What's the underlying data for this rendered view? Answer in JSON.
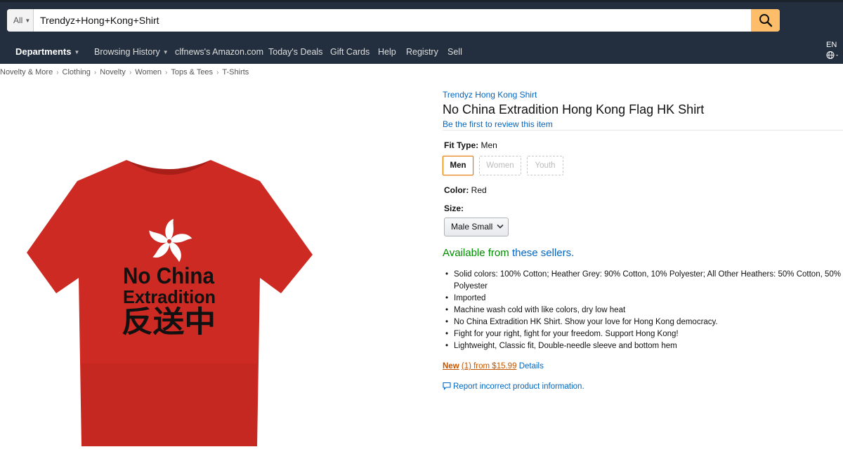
{
  "search": {
    "category": "All",
    "query": "Trendyz+Hong+Kong+Shirt",
    "button_icon": "search-icon"
  },
  "nav": {
    "departments": "Departments",
    "browsing_history": "Browsing History",
    "amazon_link": "clfnews's Amazon.com",
    "todays_deals": "Today's Deals",
    "gift_cards": "Gift Cards",
    "help": "Help",
    "registry": "Registry",
    "sell": "Sell",
    "language": "EN",
    "globe_icon": "globe-icon"
  },
  "breadcrumb": [
    "Novelty & More",
    "Clothing",
    "Novelty",
    "Women",
    "Tops & Tees",
    "T-Shirts"
  ],
  "product": {
    "brand": "Trendyz Hong Kong Shirt",
    "title": "No China Extradition Hong Kong Flag HK Shirt",
    "review_link": "Be the first to review this item",
    "shirt_color_hex": "#cc2a22",
    "print": {
      "line1": "No China",
      "line2": "Extradition",
      "line3": "反送中"
    },
    "fit_type": {
      "label": "Fit Type:",
      "value": "Men",
      "options": [
        "Men",
        "Women",
        "Youth"
      ]
    },
    "color": {
      "label": "Color:",
      "value": "Red"
    },
    "size": {
      "label": "Size:",
      "selected": "Male Small"
    },
    "availability": {
      "prefix": "Available from ",
      "link": "these sellers."
    },
    "bullets": [
      "Solid colors: 100% Cotton; Heather Grey: 90% Cotton, 10% Polyester; All Other Heathers: 50% Cotton, 50% Polyester",
      "Imported",
      "Machine wash cold with like colors, dry low heat",
      "No China Extradition HK Shirt. Show your love for Hong Kong democracy.",
      "Fight for your right, fight for your freedom. Support Hong Kong!",
      "Lightweight, Classic fit, Double-needle sleeve and bottom hem"
    ],
    "offer": {
      "new": "New",
      "count": "(1) from $15.99",
      "details": "Details"
    },
    "report": "Report incorrect product information."
  }
}
